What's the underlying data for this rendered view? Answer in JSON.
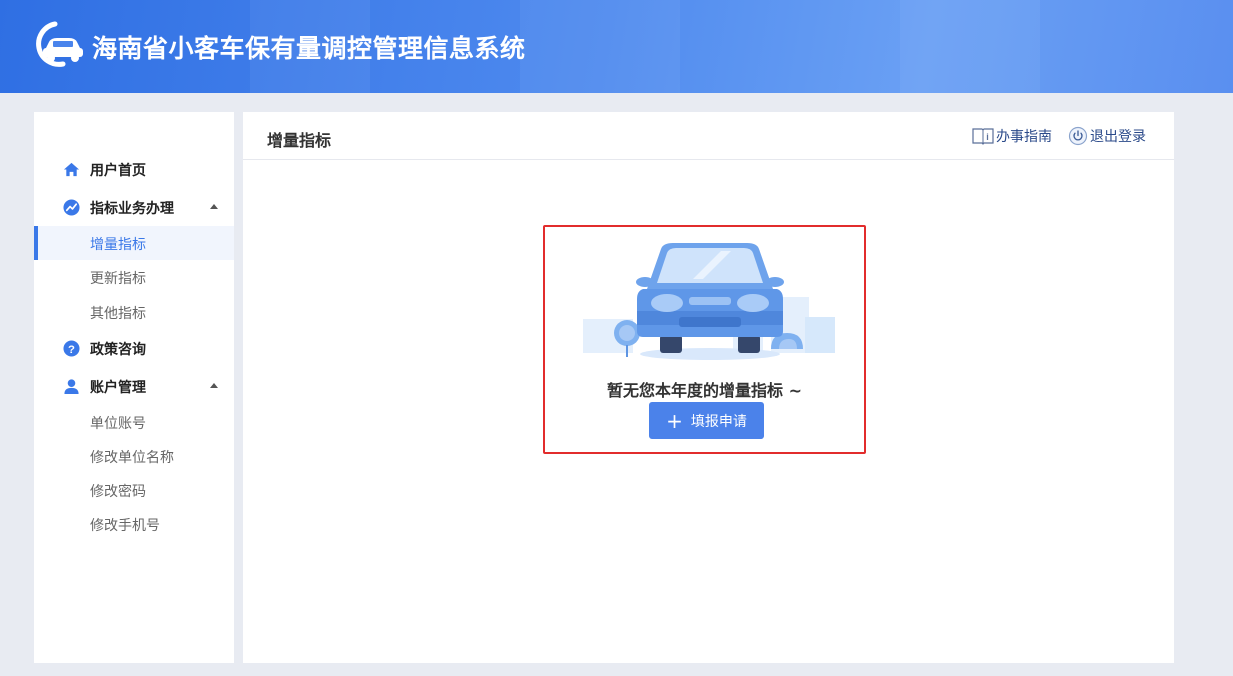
{
  "app": {
    "title": "海南省小客车保有量调控管理信息系统",
    "logo_icon": "car-logo-icon"
  },
  "sidebar": {
    "groups": [
      {
        "label": "用户首页",
        "icon": "home-icon",
        "expanded": false
      },
      {
        "label": "指标业务办理",
        "icon": "trend-icon",
        "expanded": true,
        "items": [
          {
            "label": "增量指标",
            "active": true
          },
          {
            "label": "更新指标"
          },
          {
            "label": "其他指标"
          }
        ]
      },
      {
        "label": "政策咨询",
        "icon": "question-icon",
        "expanded": false
      },
      {
        "label": "账户管理",
        "icon": "user-icon",
        "expanded": true,
        "items": [
          {
            "label": "单位账号"
          },
          {
            "label": "修改单位名称"
          },
          {
            "label": "修改密码"
          },
          {
            "label": "修改手机号"
          }
        ]
      }
    ]
  },
  "main": {
    "title": "增量指标",
    "header_links": {
      "guide": "办事指南",
      "logout": "退出登录"
    },
    "empty": {
      "message": "暂无您本年度的增量指标 ~",
      "button": "填报申请",
      "button_icon": "plus-icon"
    }
  },
  "colors": {
    "accent": "#3a78e8",
    "button": "#4b82ea",
    "highlight_border": "#e22c2c",
    "header_start": "#2f6fe3",
    "header_end": "#6aa0f4"
  }
}
